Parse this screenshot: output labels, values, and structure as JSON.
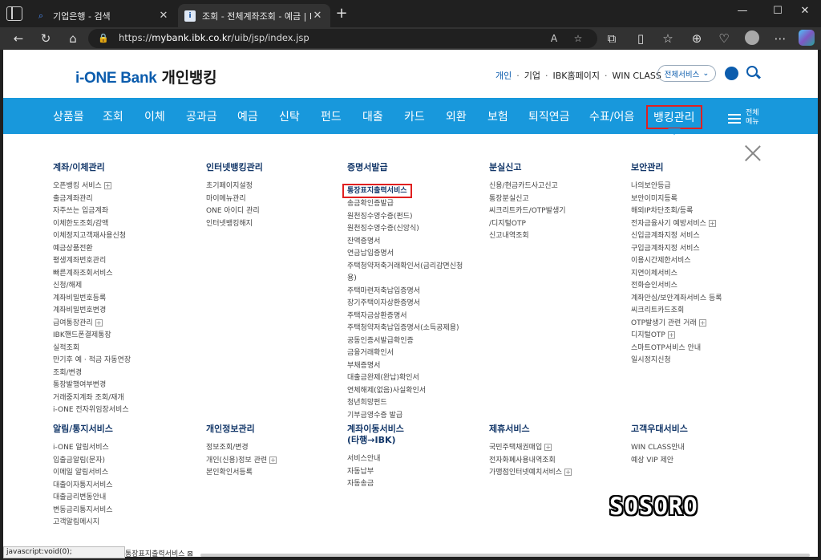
{
  "browser": {
    "tabs": [
      {
        "title": "기업은행 - 검색",
        "icon": "search-icon"
      },
      {
        "title": "조회 - 전체계좌조회 - 예금 | IBK",
        "icon": "ibk-favicon"
      }
    ],
    "url_prefix": "https://",
    "url_host": "mybank.ibk.co.kr",
    "url_path": "/uib/jsp/index.jsp",
    "reader_label": "A"
  },
  "site": {
    "logo_brand": "i-ONE Bank",
    "logo_suffix": "개인뱅킹",
    "topnav": [
      "개인",
      "기업",
      "IBK홈페이지",
      "WIN CLASS"
    ],
    "all_services": "전체서비스",
    "menu_label": "전체 메뉴"
  },
  "mainnav": [
    "상품몰",
    "조회",
    "이체",
    "공과금",
    "예금",
    "신탁",
    "펀드",
    "대출",
    "카드",
    "외환",
    "보험",
    "퇴직연금",
    "수표/어음",
    "뱅킹관리"
  ],
  "megamenu": {
    "row1": [
      {
        "title": "계좌/이체관리",
        "items": [
          {
            "t": "오픈뱅킹 서비스",
            "plus": true
          },
          {
            "t": "출금계좌관리"
          },
          {
            "t": "자주쓰는 입금계좌"
          },
          {
            "t": "이체한도조회/감액"
          },
          {
            "t": "이체정지고객재사용신청"
          },
          {
            "t": "예금상품전환"
          },
          {
            "t": "평생계좌번호관리"
          },
          {
            "t": "빠른계좌조회서비스\n신청/해제"
          },
          {
            "t": "계좌비밀번호등록"
          },
          {
            "t": "계좌비밀번호변경"
          },
          {
            "t": "급여통장관리",
            "plus": true
          },
          {
            "t": "IBK핸드폰결제통장\n실적조회"
          },
          {
            "t": "만기후 예 · 적금 자동연장\n조회/변경"
          },
          {
            "t": "통장발행여부변경"
          },
          {
            "t": "거래중지계좌 조회/재개"
          },
          {
            "t": "i-ONE 전자위임장서비스"
          }
        ]
      },
      {
        "title": "인터넷뱅킹관리",
        "items": [
          {
            "t": "초기페이지설정"
          },
          {
            "t": "마이메뉴관리"
          },
          {
            "t": "ONE 아이디 관리"
          },
          {
            "t": "인터넷뱅킹해지"
          }
        ]
      },
      {
        "title": "증명서발급",
        "items": [
          {
            "t": "통장표지출력서비스",
            "hl": true
          },
          {
            "t": "송금확인증발급"
          },
          {
            "t": "원천징수영수증(펀드)"
          },
          {
            "t": "원천징수영수증(신앙식)"
          },
          {
            "t": "잔액증명서"
          },
          {
            "t": "연금납입증명서"
          },
          {
            "t": "주택청약저축거래확인서(금리감면신청\n용)"
          },
          {
            "t": "주택마련저축납입증명서"
          },
          {
            "t": "장기주택이자상환증명서"
          },
          {
            "t": "주택자금상환증명서"
          },
          {
            "t": "주택청약저축납입증명서(소득공제용)"
          },
          {
            "t": "공동인증서발급확인증"
          },
          {
            "t": "금융거래확인서"
          },
          {
            "t": "부채증명서"
          },
          {
            "t": "대출금완제(완납)확인서"
          },
          {
            "t": "연체해제(없음)사실확인서"
          },
          {
            "t": "청년희망펀드\n기부금영수증 발급"
          }
        ]
      },
      {
        "title": "분실신고",
        "items": [
          {
            "t": "신용/현금카드사고신고"
          },
          {
            "t": "통장분실신고"
          },
          {
            "t": "씨크리트카드/OTP발생기\n/디지털OTP"
          },
          {
            "t": "신고내역조회"
          }
        ]
      },
      {
        "title": "보안관리",
        "items": [
          {
            "t": "나의보안등급"
          },
          {
            "t": "보안이미지등록"
          },
          {
            "t": "해외IP차단조회/등록"
          },
          {
            "t": "전자금융사기 예방서비스",
            "plus": true
          },
          {
            "t": "신입금계좌지정 서비스"
          },
          {
            "t": "구입금계좌지정 서비스"
          },
          {
            "t": "이용시간제한서비스"
          },
          {
            "t": "지연이체서비스"
          },
          {
            "t": "전화승인서비스"
          },
          {
            "t": "계좌안심/보안계좌서비스 등록"
          },
          {
            "t": "씨크리트카드조회"
          },
          {
            "t": "OTP발생기 관련 거래",
            "plus": true
          },
          {
            "t": "디지털OTP",
            "plus": true
          },
          {
            "t": "스마트OTP서비스 안내"
          },
          {
            "t": "일시정지신청"
          }
        ]
      }
    ],
    "row2": [
      {
        "title": "알림/통지서비스",
        "items": [
          {
            "t": "i-ONE 알림서비스"
          },
          {
            "t": "입출금알림(문자)"
          },
          {
            "t": "이메일 알림서비스"
          },
          {
            "t": "대출이자통지서비스"
          },
          {
            "t": "대출금리변동안내"
          },
          {
            "t": "변동금리통지서비스"
          },
          {
            "t": "고객알림메시지"
          }
        ]
      },
      {
        "title": "개인정보관리",
        "items": [
          {
            "t": "정보조회/변경"
          },
          {
            "t": "개인(신용)정보 관련",
            "plus": true
          },
          {
            "t": "본인확인서등록"
          }
        ]
      },
      {
        "title": "계좌이동서비스\n(타행→IBK)",
        "items": [
          {
            "t": "서비스안내"
          },
          {
            "t": "자동납부"
          },
          {
            "t": "자동송금"
          }
        ]
      },
      {
        "title": "제휴서비스",
        "items": [
          {
            "t": "국민주택채권매입",
            "plus": true
          },
          {
            "t": "전자화폐사용내역조회"
          },
          {
            "t": "가맹점인터넷예치서비스",
            "plus": true
          }
        ]
      },
      {
        "title": "고객우대서비스",
        "items": [
          {
            "t": "WIN CLASS안내"
          },
          {
            "t": "예상 VIP 제안"
          }
        ]
      }
    ]
  },
  "status_url": "javascript:void(0);",
  "bottom_tab": "통장표지출력서비스",
  "watermark": "SOSORO",
  "colors": {
    "nav_blue": "#1898dc",
    "brand_blue": "#0b5cad",
    "highlight_red": "#e02020"
  }
}
